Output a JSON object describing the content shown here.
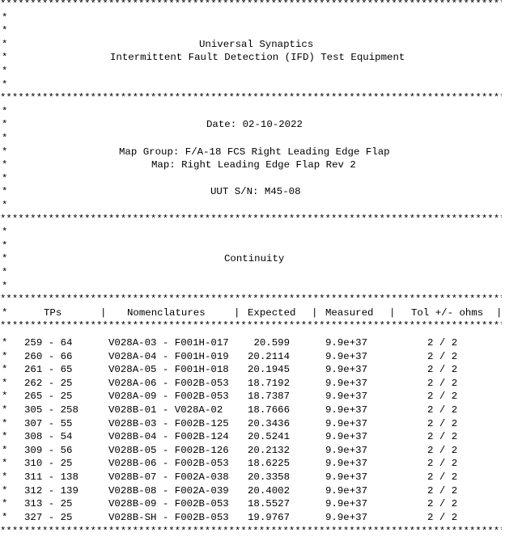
{
  "border_char": "*",
  "header": {
    "company": "Universal Synaptics",
    "product": "Intermittent Fault Detection (IFD) Test Equipment"
  },
  "info": {
    "date": "Date: 02-10-2022",
    "map_group": "Map Group: F/A-18 FCS Right Leading Edge Flap",
    "map": "Map: Right Leading Edge Flap Rev 2",
    "uut_sn": "UUT S/N: M45-08"
  },
  "section_title": "Continuity",
  "table": {
    "columns": [
      "TPs",
      "Nomenclatures",
      "Expected",
      "Measured",
      "Tol +/- ohms"
    ],
    "rows": [
      {
        "tps": "259 - 64",
        "nom": "V028A-03 - F001H-017",
        "expected": "20.599",
        "measured": "9.9e+37",
        "tol": "2 / 2"
      },
      {
        "tps": "260 - 66",
        "nom": "V028A-04 - F001H-019",
        "expected": "20.2114",
        "measured": "9.9e+37",
        "tol": "2 / 2"
      },
      {
        "tps": "261 - 65",
        "nom": "V028A-05 - F001H-018",
        "expected": "20.1945",
        "measured": "9.9e+37",
        "tol": "2 / 2"
      },
      {
        "tps": "262 - 25",
        "nom": "V028A-06 - F002B-053",
        "expected": "18.7192",
        "measured": "9.9e+37",
        "tol": "2 / 2"
      },
      {
        "tps": "265 - 25",
        "nom": "V028A-09 - F002B-053",
        "expected": "18.7387",
        "measured": "9.9e+37",
        "tol": "2 / 2"
      },
      {
        "tps": "305 - 258",
        "nom": "V028B-01 - V028A-02",
        "expected": "18.7666",
        "measured": "9.9e+37",
        "tol": "2 / 2"
      },
      {
        "tps": "307 - 55",
        "nom": "V028B-03 - F002B-125",
        "expected": "20.3436",
        "measured": "9.9e+37",
        "tol": "2 / 2"
      },
      {
        "tps": "308 - 54",
        "nom": "V028B-04 - F002B-124",
        "expected": "20.5241",
        "measured": "9.9e+37",
        "tol": "2 / 2"
      },
      {
        "tps": "309 - 56",
        "nom": "V028B-05 - F002B-126",
        "expected": "20.2132",
        "measured": "9.9e+37",
        "tol": "2 / 2"
      },
      {
        "tps": "310 - 25",
        "nom": "V028B-06 - F002B-053",
        "expected": "18.6225",
        "measured": "9.9e+37",
        "tol": "2 / 2"
      },
      {
        "tps": "311 - 138",
        "nom": "V028B-07 - F002A-038",
        "expected": "20.3358",
        "measured": "9.9e+37",
        "tol": "2 / 2"
      },
      {
        "tps": "312 - 139",
        "nom": "V028B-08 - F002A-039",
        "expected": "20.4002",
        "measured": "9.9e+37",
        "tol": "2 / 2"
      },
      {
        "tps": "313 - 25",
        "nom": "V028B-09 - F002B-053",
        "expected": "18.5527",
        "measured": "9.9e+37",
        "tol": "2 / 2"
      },
      {
        "tps": "327 - 25",
        "nom": "V028B-SH - F002B-053",
        "expected": "19.9767",
        "measured": "9.9e+37",
        "tol": "2 / 2"
      }
    ]
  }
}
